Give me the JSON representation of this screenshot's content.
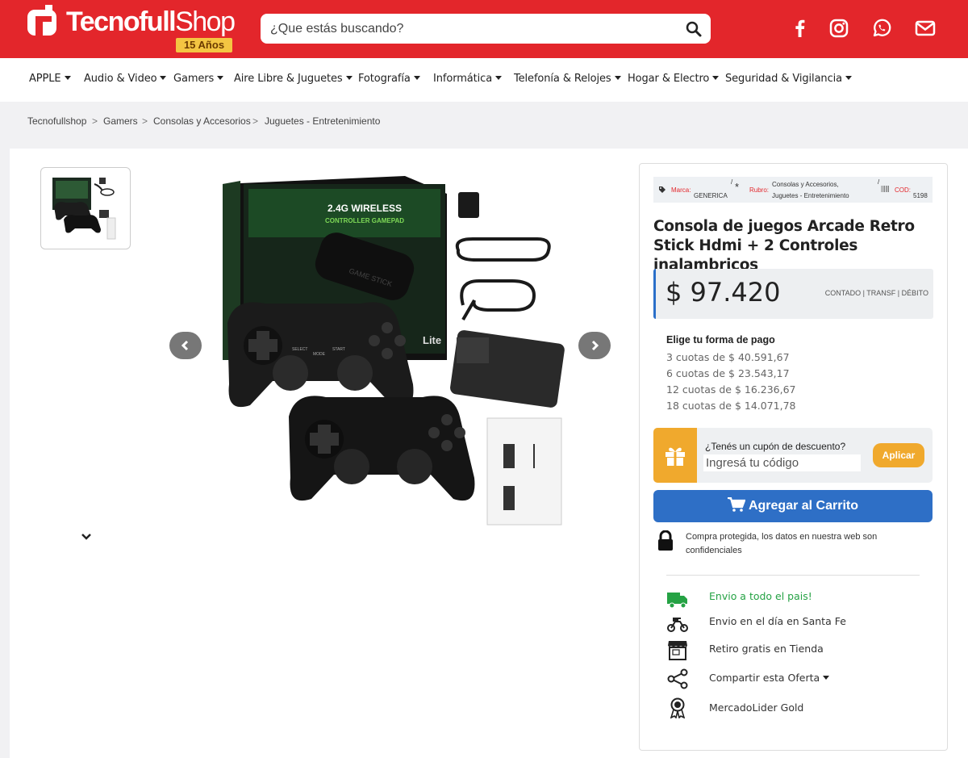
{
  "header": {
    "logo_main": "Tecnofull",
    "logo_light": "Shop",
    "logo_badge": "15 Años",
    "search_placeholder": "¿Que estás buscando?"
  },
  "nav": [
    {
      "label": "APPLE"
    },
    {
      "label": "Audio & Video"
    },
    {
      "label": "Gamers"
    },
    {
      "label": "Aire Libre & Juguetes"
    },
    {
      "label": "Fotografía"
    },
    {
      "label": "Informática"
    },
    {
      "label": "Telefonía & Relojes"
    },
    {
      "label": "Hogar & Electro"
    },
    {
      "label": "Seguridad & Vigilancia"
    }
  ],
  "breadcrumb": [
    "Tecnofullshop",
    "Gamers",
    "Consolas y Accesorios",
    "Juguetes - Entretenimiento"
  ],
  "breadcrumb_sep": ">",
  "product": {
    "meta": {
      "brand_label": "Marca:",
      "brand_value": "GENERICA",
      "category_label": "Rubro:",
      "category_value_1": "Consolas y Accesorios,",
      "category_value_2": "Juguetes - Entretenimiento",
      "code_label": "COD:",
      "code_value": "5198"
    },
    "title": "Consola de juegos Arcade Retro Stick Hdmi + 2 Controles inalambricos",
    "price": "$ 97.420",
    "price_note": "CONTADO | TRANSF | DÉBITO",
    "payment_title": "Elige tu forma de pago",
    "quotas": [
      "3 cuotas de $ 40.591,67",
      "6 cuotas de $ 23.543,17",
      "12 cuotas de $ 16.236,67",
      "18 cuotas de $ 14.071,78"
    ],
    "image_texts": {
      "box_title": "2.4G WIRELESS",
      "box_subtitle": "CONTROLLER GAMEPAD",
      "box_brand": "GAME STICK",
      "box_lite": "Lite",
      "select": "SELECT",
      "mode": "MODE",
      "start": "START"
    }
  },
  "coupon": {
    "label": "¿Tenés un cupón de descuento?",
    "placeholder": "Ingresá tu código",
    "button": "Aplicar"
  },
  "cart_button": "Agregar al Carrito",
  "secure_text": "Compra protegida, los datos en nuestra web son confidenciales",
  "features": [
    {
      "label": "Envio a todo el pais!",
      "icon": "truck-icon"
    },
    {
      "label": "Envio en el día en Santa Fe",
      "icon": "motorbike-icon"
    },
    {
      "label": "Retiro gratis en Tienda",
      "icon": "store-icon"
    },
    {
      "label": "Compartir esta Oferta",
      "icon": "share-icon"
    },
    {
      "label": "MercadoLider Gold",
      "icon": "medal-icon"
    }
  ],
  "colors": {
    "brand_red": "#e3262b",
    "blue": "#2e6fc6",
    "orange": "#f0a92d",
    "green": "#25a244"
  }
}
